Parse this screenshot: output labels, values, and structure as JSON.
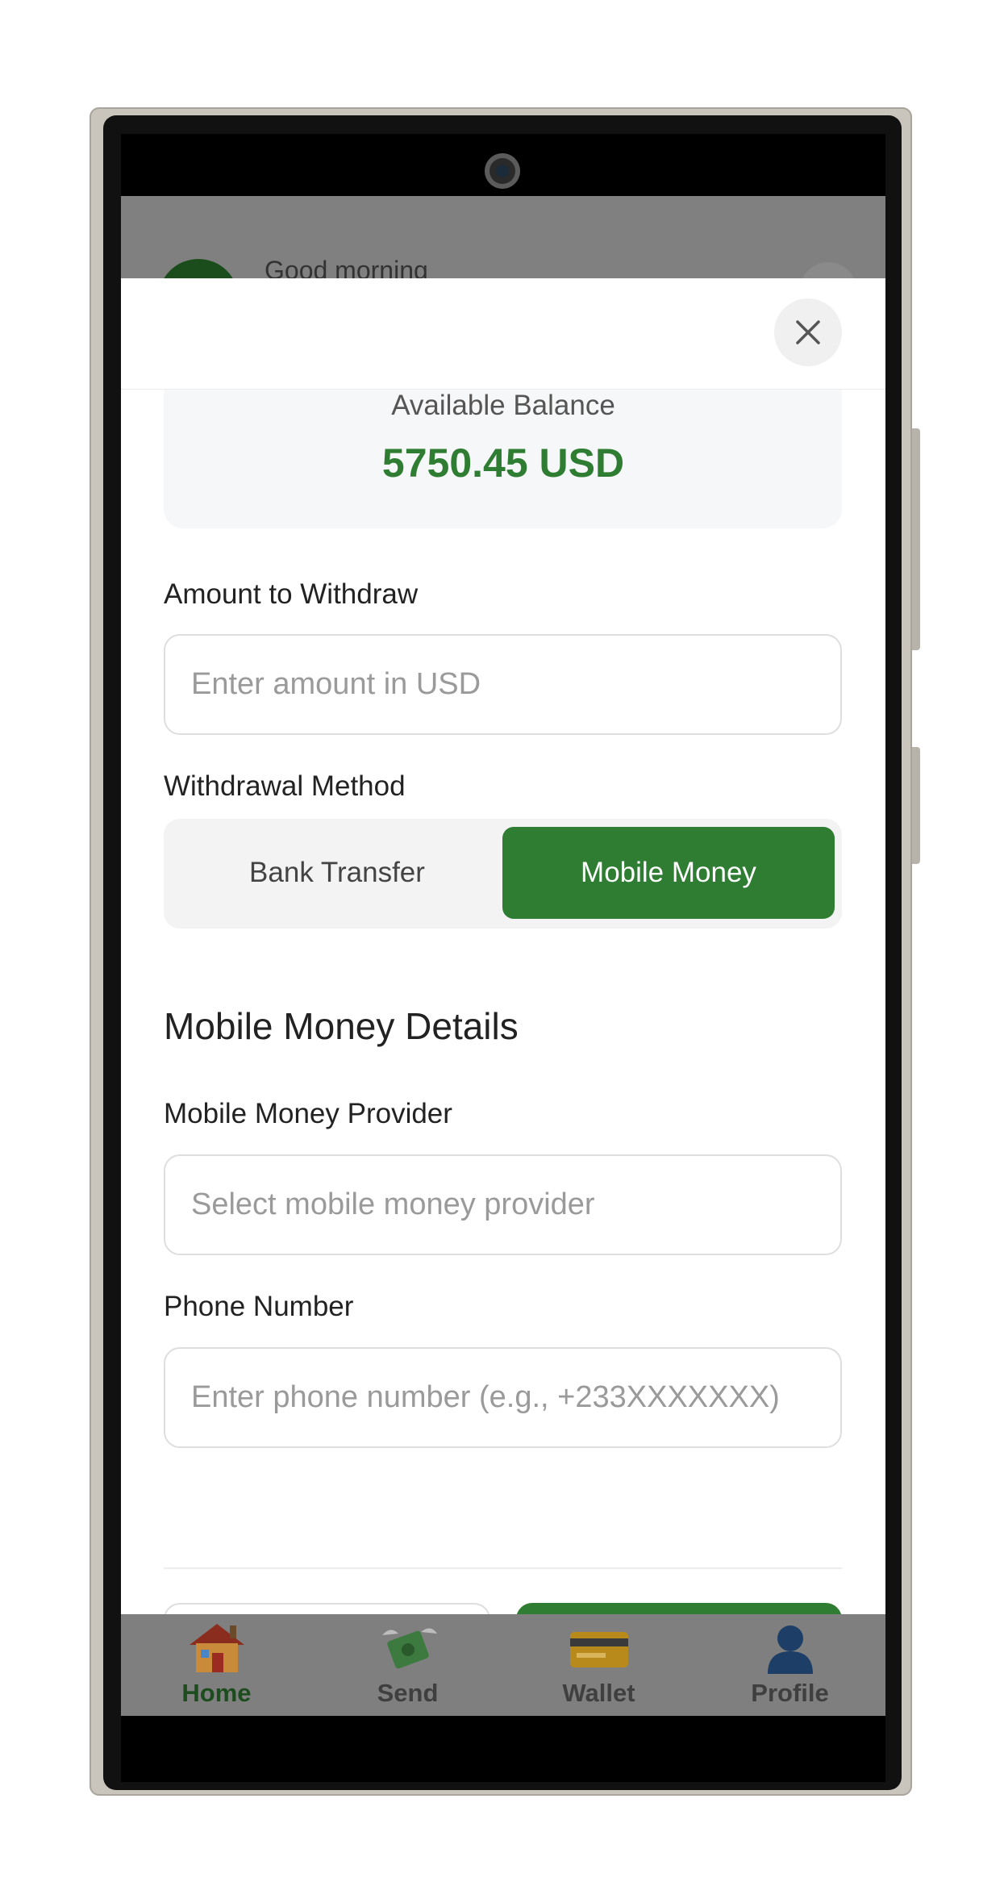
{
  "background": {
    "greeting": "Good morning"
  },
  "sheet": {
    "balance": {
      "label": "Available Balance",
      "value": "5750.45 USD"
    },
    "amount": {
      "label": "Amount to Withdraw",
      "placeholder": "Enter amount in USD",
      "value": ""
    },
    "method": {
      "label": "Withdrawal Method",
      "options": [
        "Bank Transfer",
        "Mobile Money"
      ],
      "selected": "Mobile Money"
    },
    "mobile_money": {
      "section_title": "Mobile Money Details",
      "provider_label": "Mobile Money Provider",
      "provider_placeholder": "Select mobile money provider",
      "phone_label": "Phone Number",
      "phone_placeholder": "Enter phone number (e.g., +233XXXXXXX)"
    }
  },
  "nav": {
    "items": [
      {
        "label": "Home",
        "icon": "house-icon",
        "active": true
      },
      {
        "label": "Send",
        "icon": "money-with-wings-icon",
        "active": false
      },
      {
        "label": "Wallet",
        "icon": "credit-card-icon",
        "active": false
      },
      {
        "label": "Profile",
        "icon": "person-silhouette-icon",
        "active": false
      }
    ]
  },
  "colors": {
    "accent": "#2e7d32",
    "overlay": "#808080"
  }
}
